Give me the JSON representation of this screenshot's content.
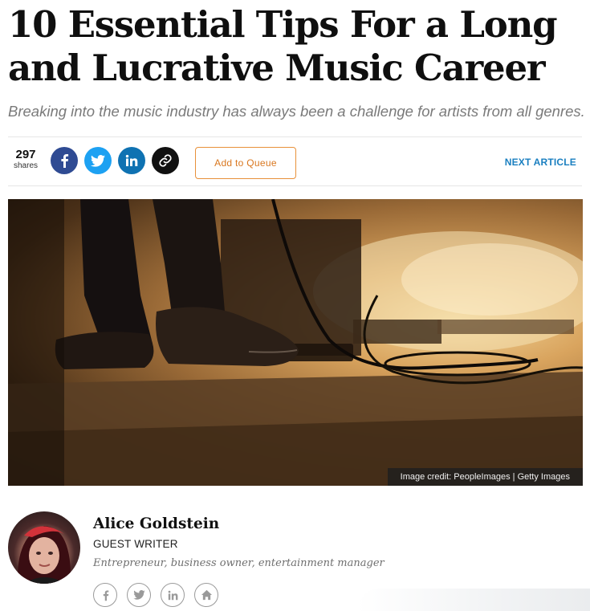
{
  "article": {
    "title": "10 Essential Tips For a Long and Lucrative Music Career",
    "subtitle": "Breaking into the music industry has always been a challenge for artists from all genres."
  },
  "share_bar": {
    "share_count": "297",
    "share_label": "shares",
    "buttons": [
      {
        "icon": "facebook-icon",
        "color": "#2f4b93"
      },
      {
        "icon": "twitter-icon",
        "color": "#1da1f2"
      },
      {
        "icon": "linkedin-icon",
        "color": "#0f72b2"
      },
      {
        "icon": "link-icon",
        "color": "#111111"
      }
    ],
    "queue_label": "Add to Queue",
    "next_label": "NEXT ARTICLE"
  },
  "hero_image": {
    "credit": "Image credit: PeopleImages | Getty Images"
  },
  "author": {
    "name": "Alice Goldstein",
    "role": "GUEST WRITER",
    "bio": "Entrepreneur, business owner, entertainment manager",
    "social_icons": [
      "facebook-icon",
      "twitter-icon",
      "linkedin-icon",
      "home-icon"
    ]
  },
  "colors": {
    "accent_orange": "#e8913a",
    "link_blue": "#1a7fc0"
  }
}
